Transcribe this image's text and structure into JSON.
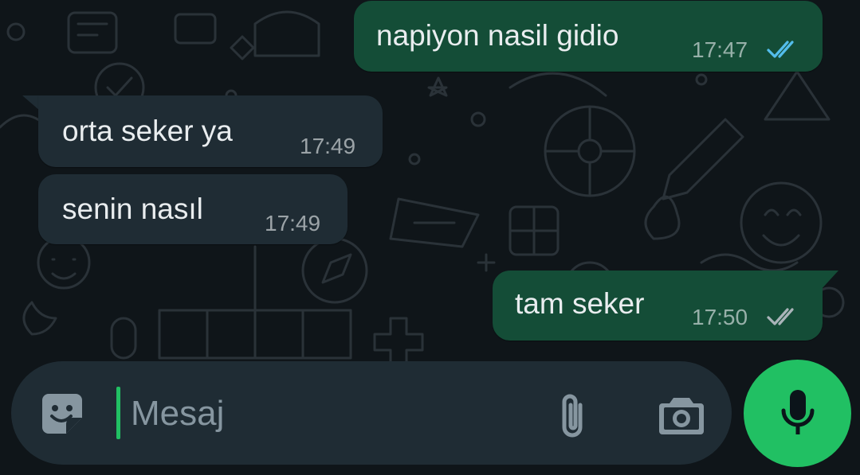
{
  "messages": [
    {
      "direction": "outgoing",
      "text": "napiyon nasil gidio",
      "time": "17:47",
      "status": "read"
    },
    {
      "direction": "incoming",
      "text": "orta seker ya",
      "time": "17:49"
    },
    {
      "direction": "incoming",
      "text": "senin nasıl",
      "time": "17:49"
    },
    {
      "direction": "outgoing",
      "text": "tam seker",
      "time": "17:50",
      "status": "delivered"
    }
  ],
  "composer": {
    "placeholder": "Mesaj",
    "icons": [
      "sticker-icon",
      "attach-icon",
      "camera-icon",
      "mic-icon"
    ]
  },
  "colors": {
    "background": "#0f1519",
    "outgoing_bubble": "#144d37",
    "incoming_bubble": "#1f2c34",
    "accent": "#21c063",
    "read_tick": "#53bdeb",
    "delivered_tick": "#aab4b9"
  }
}
